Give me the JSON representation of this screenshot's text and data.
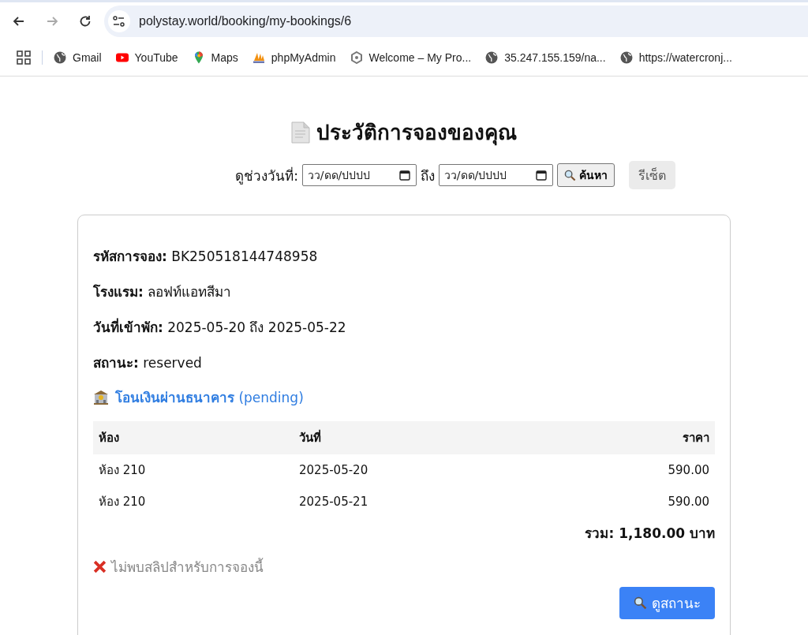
{
  "browser": {
    "url": "polystay.world/booking/my-bookings/6",
    "forward_disabled": true,
    "bookmarks": [
      {
        "label": "Gmail",
        "kind": "globe"
      },
      {
        "label": "YouTube",
        "kind": "youtube"
      },
      {
        "label": "Maps",
        "kind": "maps"
      },
      {
        "label": "phpMyAdmin",
        "kind": "pma"
      },
      {
        "label": "Welcome – My Pro...",
        "kind": "hex"
      },
      {
        "label": "35.247.155.159/na...",
        "kind": "globe"
      },
      {
        "label": "https://watercronj...",
        "kind": "globe"
      }
    ]
  },
  "page": {
    "title": "ประวัติการจองของคุณ",
    "filter": {
      "label": "ดูช่วงวันที่:",
      "from_placeholder": "วว/ดด/ปปปป",
      "between": "ถึง",
      "to_placeholder": "วว/ดด/ปปปป",
      "search_button": "ค้นหา",
      "reset_button": "รีเซ็ต"
    },
    "booking": {
      "fields": [
        {
          "label": "รหัสการจอง:",
          "value": "BK250518144748958"
        },
        {
          "label": "โรงแรม:",
          "value": "ลอฟท์แอทสีมา"
        },
        {
          "label": "วันที่เข้าพัก:",
          "value": "2025-05-20 ถึง 2025-05-22"
        },
        {
          "label": "สถานะ:",
          "value": "reserved"
        }
      ],
      "payment": {
        "method": "โอนเงินผ่านธนาคาร",
        "status": "(pending)"
      },
      "table": {
        "columns": [
          "ห้อง",
          "วันที่",
          "ราคา"
        ],
        "rows": [
          [
            "ห้อง 210",
            "2025-05-20",
            "590.00"
          ],
          [
            "ห้อง 210",
            "2025-05-21",
            "590.00"
          ]
        ]
      },
      "total": "รวม: 1,180.00 บาท",
      "slip_message": "ไม่พบสลิปสำหรับการจองนี้",
      "status_button": "ดูสถานะ"
    }
  }
}
